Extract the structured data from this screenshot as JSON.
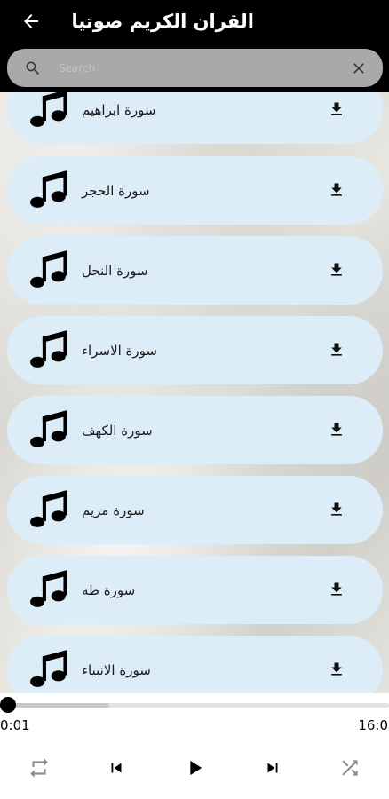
{
  "app_bar": {
    "title": "القران الكريم صوتيا",
    "back_icon": "arrow-left-icon"
  },
  "search": {
    "placeholder": "Search",
    "value": "",
    "icon": "search-icon",
    "clear_icon": "close-icon"
  },
  "surah_list": [
    {
      "label": "سورة ابراهيم",
      "icon": "music-note-icon",
      "action_icon": "download-icon"
    },
    {
      "label": "سورة الحجر",
      "icon": "music-note-icon",
      "action_icon": "download-icon"
    },
    {
      "label": "سورة النحل",
      "icon": "music-note-icon",
      "action_icon": "download-icon"
    },
    {
      "label": "سورة الاسراء",
      "icon": "music-note-icon",
      "action_icon": "download-icon"
    },
    {
      "label": "سورة الكهف",
      "icon": "music-note-icon",
      "action_icon": "download-icon"
    },
    {
      "label": "سورة مريم",
      "icon": "music-note-icon",
      "action_icon": "download-icon"
    },
    {
      "label": "سورة طه",
      "icon": "music-note-icon",
      "action_icon": "download-icon"
    },
    {
      "label": "سورة الانبياء",
      "icon": "music-note-icon",
      "action_icon": "download-icon"
    }
  ],
  "player": {
    "current_time": "0:01",
    "total_time": "16:0",
    "played_fraction": 0.01,
    "buffered_fraction": 0.28,
    "controls": [
      "repeat-icon",
      "skip-previous-icon",
      "play-icon",
      "skip-next-icon",
      "shuffle-icon"
    ]
  },
  "colors": {
    "app_bar": "#000000",
    "search_box": "#a9a9a9",
    "list_item": "#ddedf7",
    "player_bg": "#ffffff"
  }
}
